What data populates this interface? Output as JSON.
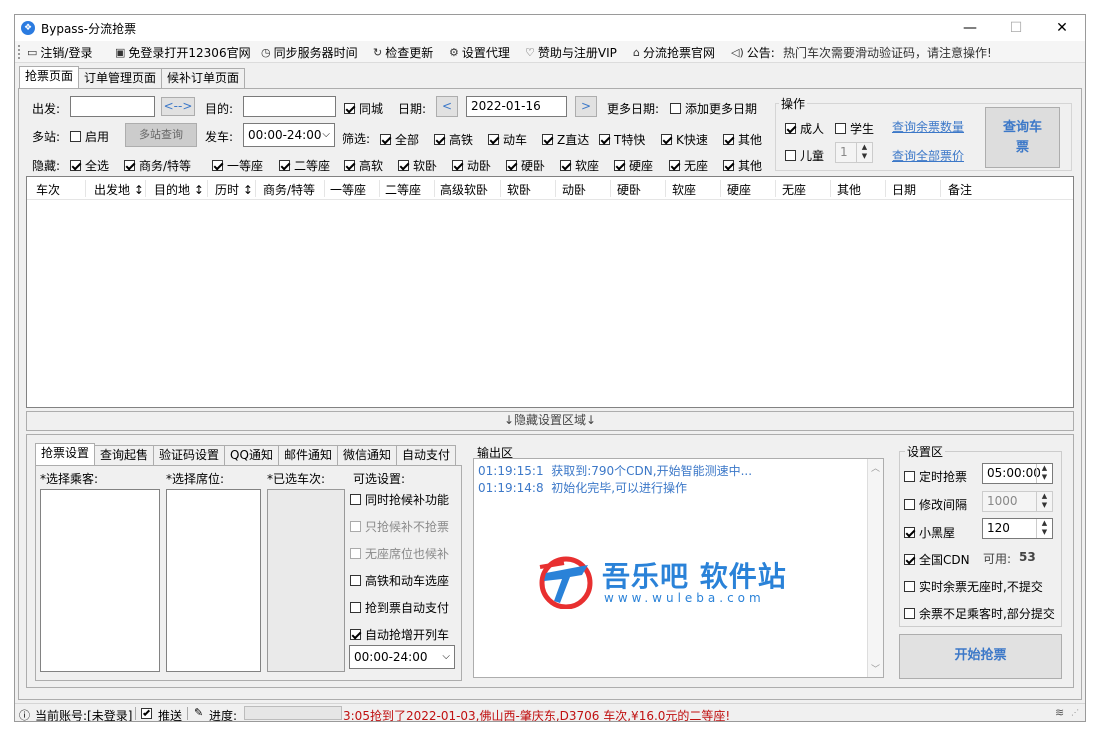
{
  "window": {
    "title": "Bypass-分流抢票",
    "minimize": "—",
    "maximize": "☐",
    "close": "✕"
  },
  "menu": [
    {
      "label": "注销/登录",
      "icon": "monitor-icon",
      "glyph": "▭"
    },
    {
      "label": "免登录打开12306官网",
      "icon": "window-icon",
      "glyph": "▣"
    },
    {
      "label": "同步服务器时间",
      "icon": "clock-icon",
      "glyph": "◷"
    },
    {
      "label": "检查更新",
      "icon": "refresh-icon",
      "glyph": "↻"
    },
    {
      "label": "设置代理",
      "icon": "gear-icon",
      "glyph": "⚙"
    },
    {
      "label": "赞助与注册VIP",
      "icon": "heart-icon",
      "glyph": "♡"
    },
    {
      "label": "分流抢票官网",
      "icon": "home-icon",
      "glyph": "⌂"
    },
    {
      "label": "公告:",
      "icon": "speaker-icon",
      "glyph": "🕪"
    }
  ],
  "notice": "热门车次需要滑动验证码，请注意操作!",
  "main_tabs": [
    "抢票页面",
    "订单管理页面",
    "候补订单页面"
  ],
  "search": {
    "from_label": "出发:",
    "from_value": "",
    "swap_label": "<-->",
    "to_label": "目的:",
    "to_value": "",
    "same_city": "同城",
    "date_label": "日期:",
    "prev": "<",
    "date_value": "2022-01-16",
    "next": ">",
    "more_dates_label": "更多日期:",
    "add_dates": "添加更多日期",
    "multi_label": "多站:",
    "enable": "启用",
    "multi_query": "多站查询",
    "depart_label": "发车:",
    "depart_value": "00:00-24:00",
    "filter_label": "筛选:",
    "filters": [
      {
        "label": "全部",
        "on": true
      },
      {
        "label": "高铁",
        "on": true
      },
      {
        "label": "动车",
        "on": true
      },
      {
        "label": "Z直达",
        "on": true
      },
      {
        "label": "T特快",
        "on": true
      },
      {
        "label": "K快速",
        "on": true
      },
      {
        "label": "其他",
        "on": true
      }
    ],
    "hide_label": "隐藏:",
    "hides": [
      {
        "label": "全选",
        "on": true
      },
      {
        "label": "商务/特等",
        "on": true
      },
      {
        "label": "一等座",
        "on": true
      },
      {
        "label": "二等座",
        "on": true
      },
      {
        "label": "高软",
        "on": true
      },
      {
        "label": "软卧",
        "on": true
      },
      {
        "label": "动卧",
        "on": true
      },
      {
        "label": "硬卧",
        "on": true
      },
      {
        "label": "软座",
        "on": true
      },
      {
        "label": "硬座",
        "on": true
      },
      {
        "label": "无座",
        "on": true
      },
      {
        "label": "其他",
        "on": true
      }
    ]
  },
  "ops": {
    "title": "操作",
    "adult": "成人",
    "student": "学生",
    "child": "儿童",
    "child_count": "1",
    "query_remaining": "查询余票数量",
    "query_prices": "查询全部票价",
    "query_btn": "查询车票"
  },
  "grid": {
    "columns": [
      "车次",
      "出发地 ↕",
      "目的地 ↕",
      "历时 ↕",
      "商务/特等",
      "一等座",
      "二等座",
      "高级软卧",
      "软卧",
      "动卧",
      "硬卧",
      "软座",
      "硬座",
      "无座",
      "其他",
      "日期",
      "备注"
    ]
  },
  "hide_settings": "↓隐藏设置区域↓",
  "settings_tabs": [
    "抢票设置",
    "查询起售",
    "验证码设置",
    "QQ通知",
    "邮件通知",
    "微信通知",
    "自动支付"
  ],
  "ticket": {
    "passengers": "*选择乘客:",
    "seats": "*选择席位:",
    "trains": "*已选车次:",
    "optional": "可选设置:",
    "options": [
      {
        "label": "同时抢候补功能",
        "on": false,
        "disabled": false
      },
      {
        "label": "只抢候补不抢票",
        "on": false,
        "disabled": true
      },
      {
        "label": "无座席位也候补",
        "on": false,
        "disabled": true
      },
      {
        "label": "高铁和动车选座",
        "on": false,
        "disabled": false
      },
      {
        "label": "抢到票自动支付",
        "on": false,
        "disabled": false
      },
      {
        "label": "自动抢增开列车",
        "on": true,
        "disabled": false
      }
    ],
    "time_range": "00:00-24:00"
  },
  "output": {
    "title": "输出区",
    "lines": [
      {
        "time": "01:19:15:1",
        "text": "获取到:790个CDN,开始智能测速中..."
      },
      {
        "time": "01:19:14:8",
        "text": "初始化完毕,可以进行操作"
      }
    ],
    "watermark": "吾乐吧 软件站",
    "watermark_sub": "www.wuleba.com"
  },
  "settings": {
    "title": "设置区",
    "timed": "定时抢票",
    "timed_value": "05:00:00",
    "interval": "修改间隔",
    "interval_value": "1000",
    "blackroom": "小黑屋",
    "blackroom_value": "120",
    "cdn": "全国CDN",
    "available_label": "可用:",
    "available_value": "53",
    "no_seat": "实时余票无座时,不提交",
    "partial": "余票不足乘客时,部分提交",
    "start": "开始抢票"
  },
  "status": {
    "account": "当前账号:[未登录]",
    "push": "推送",
    "progress_label": "进度:",
    "ticker": "3:05抢到了2022-01-03,佛山西-肇庆东,D3706 车次,¥16.0元的二等座!"
  },
  "colors": {
    "link": "#3c78c8",
    "start_text": "#3c78c8",
    "ticker": "#c01010",
    "output_text": "#3c78c8"
  }
}
